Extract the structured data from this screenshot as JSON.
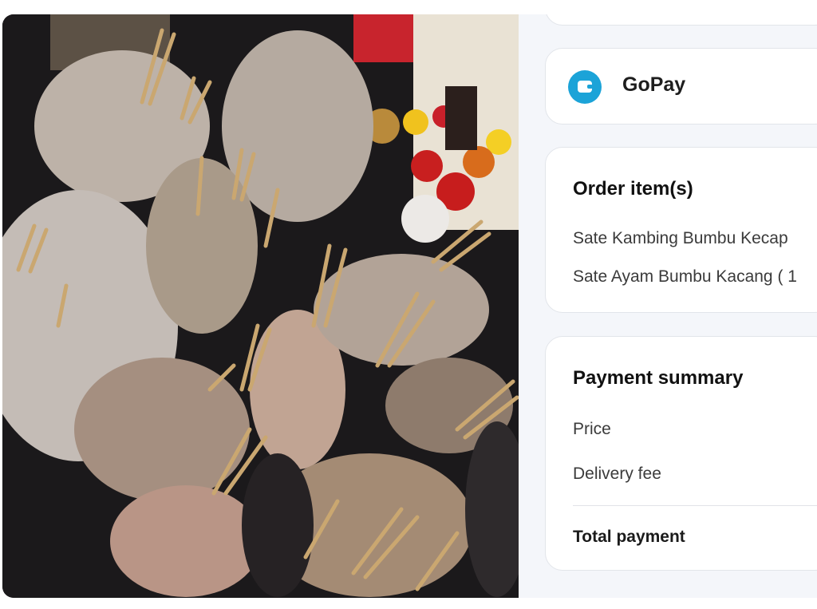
{
  "payment_method": {
    "label": "GoPay",
    "icon": "gopay-wallet-icon",
    "icon_color": "#1ba3d8"
  },
  "order_items": {
    "title": "Order item(s)",
    "items": [
      "Sate Kambing Bumbu Kecap",
      "Sate Ayam Bumbu Kacang ( 1"
    ]
  },
  "payment_summary": {
    "title": "Payment summary",
    "price_label": "Price",
    "delivery_fee_label": "Delivery fee",
    "total_label": "Total payment"
  },
  "photo": {
    "subject": "food-order-bags-photo"
  }
}
